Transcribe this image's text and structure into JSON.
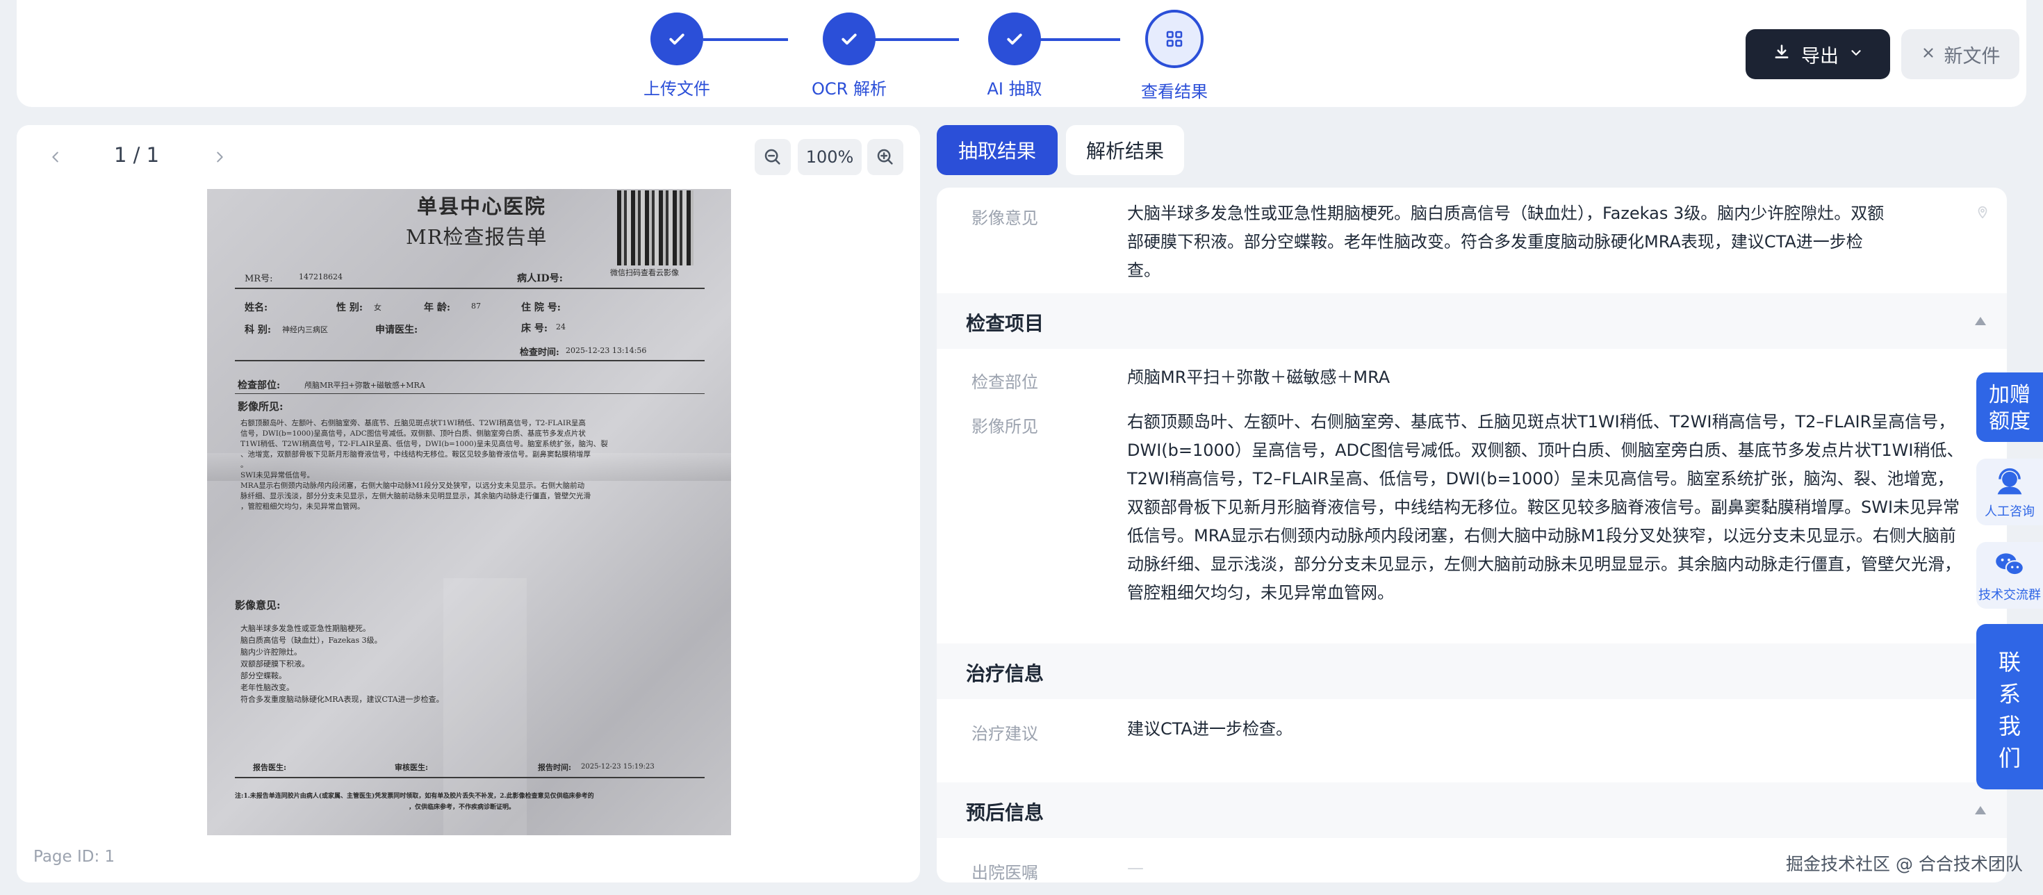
{
  "steps": [
    {
      "label": "上传文件",
      "state": "done"
    },
    {
      "label": "OCR 解析",
      "state": "done"
    },
    {
      "label": "AI 抽取",
      "state": "done"
    },
    {
      "label": "查看结果",
      "state": "current"
    }
  ],
  "toolbar": {
    "export_label": "导出",
    "newfile_label": "新文件"
  },
  "viewer": {
    "page_indicator": "1 / 1",
    "zoom": "100%",
    "page_id": "Page ID: 1"
  },
  "document": {
    "hospital": "单县中心医院",
    "title": "MR检查报告单",
    "mr_no_label": "MR号:",
    "mr_no": "147218624",
    "patient_id_label": "病人ID号:",
    "name_label": "姓名:",
    "sex_label": "性 别:",
    "sex": "女",
    "age_label": "年 龄:",
    "age": "87",
    "inpatient_label": "住 院 号:",
    "dept_label": "科 别:",
    "dept": "神经内三病区",
    "doctor_label": "申请医生:",
    "bed_label": "床 号:",
    "bed": "24",
    "exam_time_label": "检查时间:",
    "exam_time": "2025-12-23 13:14:56",
    "exam_site_label": "检查部位:",
    "exam_site": "颅脑MR平扫+弥散+磁敏感+MRA",
    "findings_label": "影像所见:",
    "findings_lines": [
      "右额顶颞岛叶、左额叶、右侧脑室旁、基底节、丘脑见斑点状T1WI稍低、T2WI稍高信号，T2-FLAIR呈高",
      "信号，DWI(b=1000)呈高信号，ADC图信号减低。双侧额、顶叶白质、侧脑室旁白质、基底节多发点片状",
      "T1WI稍低、T2WI稍高信号，T2-FLAIR呈高、低信号，DWI(b=1000)呈未见高信号。脑室系统扩张，脑沟、裂",
      "、池增宽，双额部骨板下见新月形脑脊液信号，中线结构无移位。鞍区见较多脑脊液信号。副鼻窦黏膜稍增厚",
      "。",
      "SWI未见异常低信号。",
      "MRA显示右侧颈内动脉颅内段闭塞，右侧大脑中动脉M1段分叉处狭窄，以远分支未见显示。右侧大脑前动",
      "脉纤细、显示浅淡，部分分支未见显示，左侧大脑前动脉未见明显显示，其余脑内动脉走行僵直，管壁欠光滑",
      "，管腔粗细欠均匀，未见异常血管网。"
    ],
    "opinion_label": "影像意见:",
    "opinion_lines": [
      "大脑半球多发急性或亚急性期脑梗死。",
      "脑白质高信号（缺血灶），Fazekas 3级。",
      "脑内少许腔隙灶。",
      "双额部硬膜下积液。",
      "部分空蝶鞍。",
      "老年性脑改变。",
      "符合多发重度脑动脉硬化MRA表现，建议CTA进一步检查。"
    ],
    "report_doctor_label": "报告医生:",
    "review_doctor_label": "审核医生:",
    "report_time_label": "报告时间:",
    "report_time": "2025-12-23 15:19:23",
    "footnote_1": "注:1.未报告单连同胶片由病人(或家属、主管医生)凭发票同时领取，如有单及胶片丢失不补发，2.此影像检查意见仅供临床参考的",
    "footnote_2": "，仅供临床参考，不作疾病诊断证明。",
    "qr_caption": "微信扫码查看云影像"
  },
  "result_tabs": {
    "active": "抽取结果",
    "inactive": "解析结果"
  },
  "results": {
    "top_row": {
      "label": "影像意见",
      "value": "大脑半球多发急性或亚急性期脑梗死。脑白质高信号（缺血灶），Fazekas 3级。脑内少许腔隙灶。双额部硬膜下积液。部分空蝶鞍。老年性脑改变。符合多发重度脑动脉硬化MRA表现，建议CTA进一步检查。"
    },
    "sections": [
      {
        "title": "检查项目",
        "rows": [
          {
            "label": "检查部位",
            "value": "颅脑MR平扫＋弥散＋磁敏感＋MRA"
          },
          {
            "label": "影像所见",
            "value": "右额顶颞岛叶、左额叶、右侧脑室旁、基底节、丘脑见斑点状T1WI稍低、T2WI稍高信号，T2–FLAIR呈高信号，DWI(b=1000）呈高信号，ADC图信号减低。双侧额、顶叶白质、侧脑室旁白质、基底节多发点片状T1WI稍低、T2WI稍高信号，T2–FLAIR呈高、低信号，DWI(b=1000）呈未见高信号。脑室系统扩张，脑沟、裂、池增宽，双额部骨板下见新月形脑脊液信号，中线结构无移位。鞍区见较多脑脊液信号。副鼻窦黏膜稍增厚。SWI未见异常低信号。MRA显示右侧颈内动脉颅内段闭塞，右侧大脑中动脉M1段分叉处狭窄，以远分支未见显示。右侧大脑前动脉纤细、显示浅淡，部分分支未见显示，左侧大脑前动脉未见明显显示。其余脑内动脉走行僵直，管壁欠光滑，管腔粗细欠均匀，未见异常血管网。"
          }
        ]
      },
      {
        "title": "治疗信息",
        "rows": [
          {
            "label": "治疗建议",
            "value": "建议CTA进一步检查。"
          }
        ]
      },
      {
        "title": "预后信息",
        "rows": [
          {
            "label": "出院医嘱",
            "value": "—"
          }
        ]
      }
    ]
  },
  "side_widgets": {
    "promo": "加赠额度",
    "support": "人工咨询",
    "group": "技术交流群",
    "contact": "联系我们"
  },
  "watermark": "掘金技术社区 @ 合合技术团队",
  "colors": {
    "primary": "#2b4fd8",
    "dark_button": "#1c2333",
    "accent_blue": "#2f66e6"
  }
}
